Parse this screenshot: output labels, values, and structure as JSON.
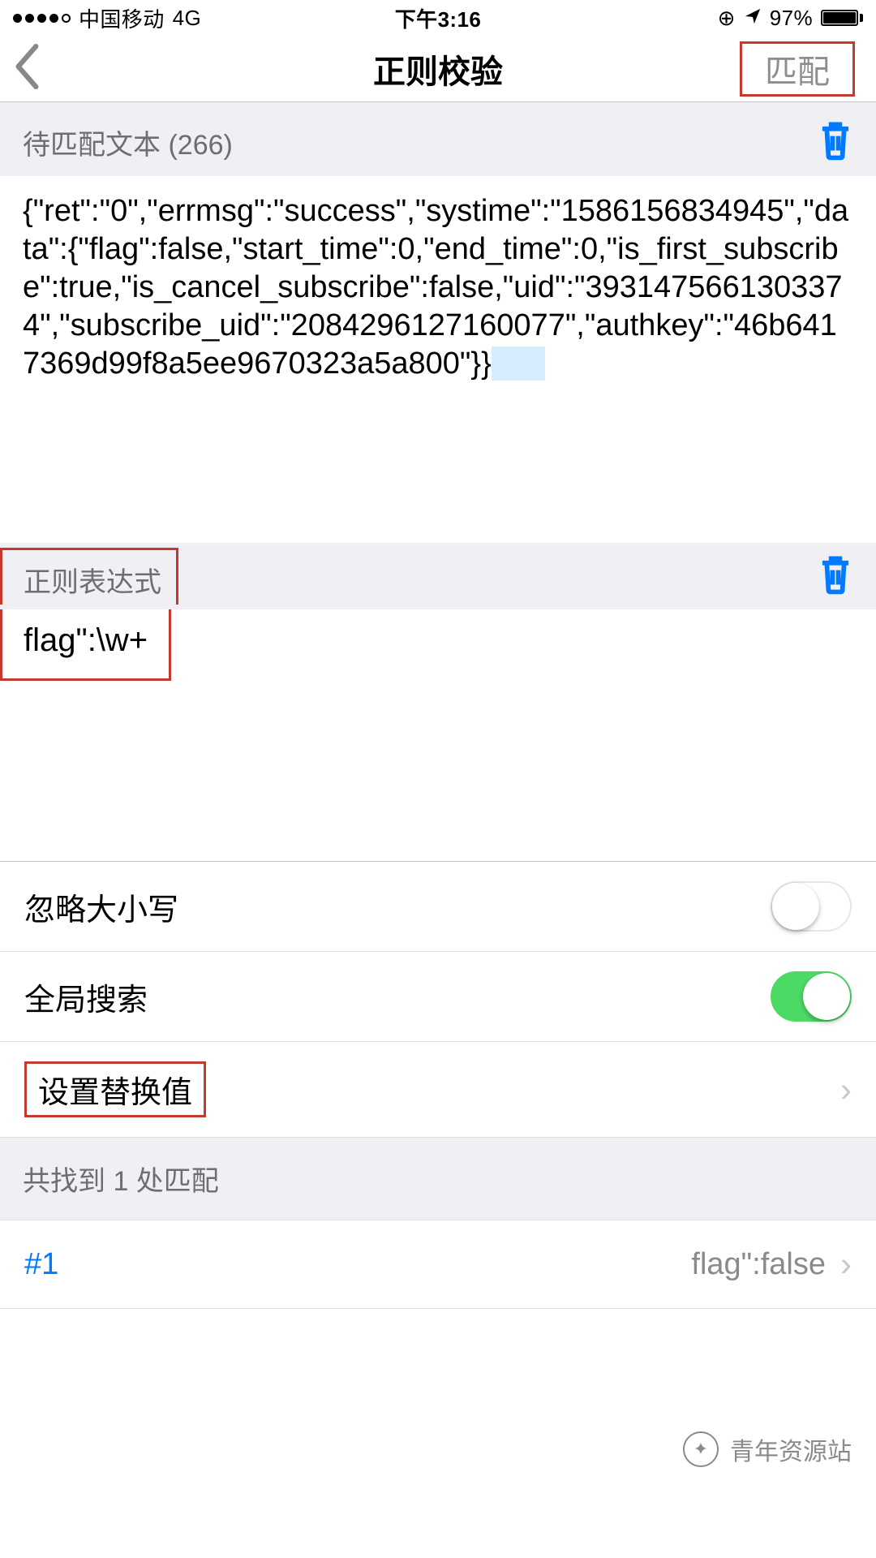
{
  "status_bar": {
    "carrier": "中国移动",
    "network": "4G",
    "time": "下午3:16",
    "battery_pct": "97%",
    "lock_icon": "⊙",
    "location_icon": "➤"
  },
  "nav": {
    "title": "正则校验",
    "action_label": "匹配",
    "highlight_color": "#c43a2f"
  },
  "input_section": {
    "label_prefix": "待匹配文本",
    "count": "266",
    "text": "{\"ret\":\"0\",\"errmsg\":\"success\",\"systime\":\"1586156834945\",\"data\":{\"flag\":false,\"start_time\":0,\"end_time\":0,\"is_first_subscribe\":true,\"is_cancel_subscribe\":false,\"uid\":\"3931475661303374\",\"subscribe_uid\":\"2084296127160077\",\"authkey\":\"46b6417369d99f8a5ee9670323a5a800\"}}"
  },
  "regex_section": {
    "label": "正则表达式",
    "pattern": "flag\":\\w+"
  },
  "options": {
    "ignore_case": {
      "label": "忽略大小写",
      "on": false
    },
    "global_search": {
      "label": "全局搜索",
      "on": true
    },
    "set_replace": {
      "label": "设置替换值"
    }
  },
  "results": {
    "header_text": "共找到 1 处匹配",
    "items": [
      {
        "index": "#1",
        "value": "flag\":false"
      }
    ]
  },
  "watermark": {
    "text": "青年资源站"
  },
  "colors": {
    "accent": "#007aff",
    "toggle_on": "#4cd964"
  }
}
